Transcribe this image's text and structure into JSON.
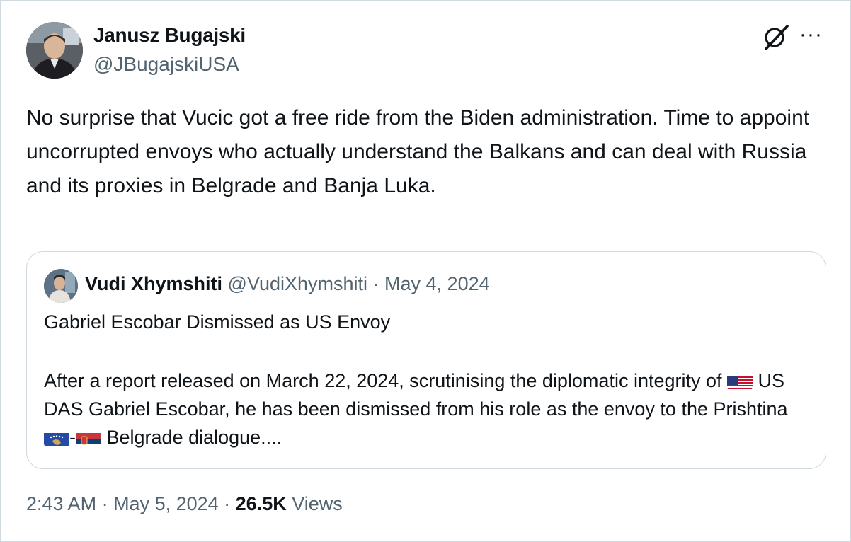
{
  "author": {
    "name": "Janusz Bugajski",
    "handle": "@JBugajskiUSA"
  },
  "icons": {
    "grok": "grok-icon",
    "more": "more-options-icon",
    "more_glyph": "···"
  },
  "tweet": {
    "text": "No surprise that Vucic got a free ride from the Biden administration. Time to appoint uncorrupted envoys who actually understand the Balkans and can deal with Russia and its proxies in Belgrade and Banja Luka."
  },
  "quoted": {
    "name": "Vudi Xhymshiti",
    "handle": "@VudiXhymshiti",
    "separator": " · ",
    "date": "May 4, 2024",
    "title": "Gabriel Escobar Dismissed as US Envoy",
    "body_part1": "After a report released on March 22, 2024, scrutinising the diplomatic integrity of ",
    "body_part2": " US DAS Gabriel Escobar, he has been dismissed from his role as the envoy to the Prishtina ",
    "body_part3": "-",
    "body_part4": " Belgrade dialogue...."
  },
  "footer": {
    "time": "2:43 AM",
    "sep1": " · ",
    "date": "May 5, 2024",
    "sep2": " · ",
    "views_count": "26.5K",
    "views_label": " Views"
  }
}
